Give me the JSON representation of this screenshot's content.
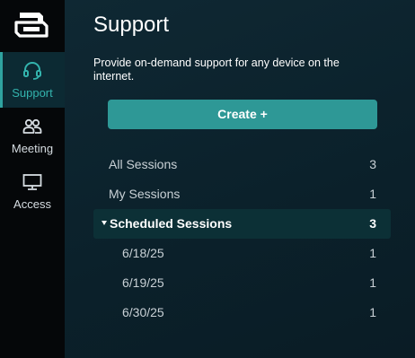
{
  "nav": {
    "items": [
      {
        "label": "Support",
        "icon": "headset-icon",
        "active": true
      },
      {
        "label": "Meeting",
        "icon": "people-icon",
        "active": false
      },
      {
        "label": "Access",
        "icon": "monitor-icon",
        "active": false
      }
    ]
  },
  "main": {
    "title": "Support",
    "description": "Provide on-demand support for any device on the internet.",
    "create_label": "Create +"
  },
  "sessions": {
    "all": {
      "label": "All Sessions",
      "count": "3"
    },
    "mine": {
      "label": "My Sessions",
      "count": "1"
    },
    "scheduled": {
      "label": "Scheduled Sessions",
      "count": "3"
    },
    "dates": [
      {
        "label": "6/18/25",
        "count": "1"
      },
      {
        "label": "6/19/25",
        "count": "1"
      },
      {
        "label": "6/30/25",
        "count": "1"
      }
    ]
  },
  "colors": {
    "accent": "#2e9896",
    "nav_bg": "#050709",
    "main_bg": "#0b212b",
    "selected_row": "#0c3036"
  }
}
